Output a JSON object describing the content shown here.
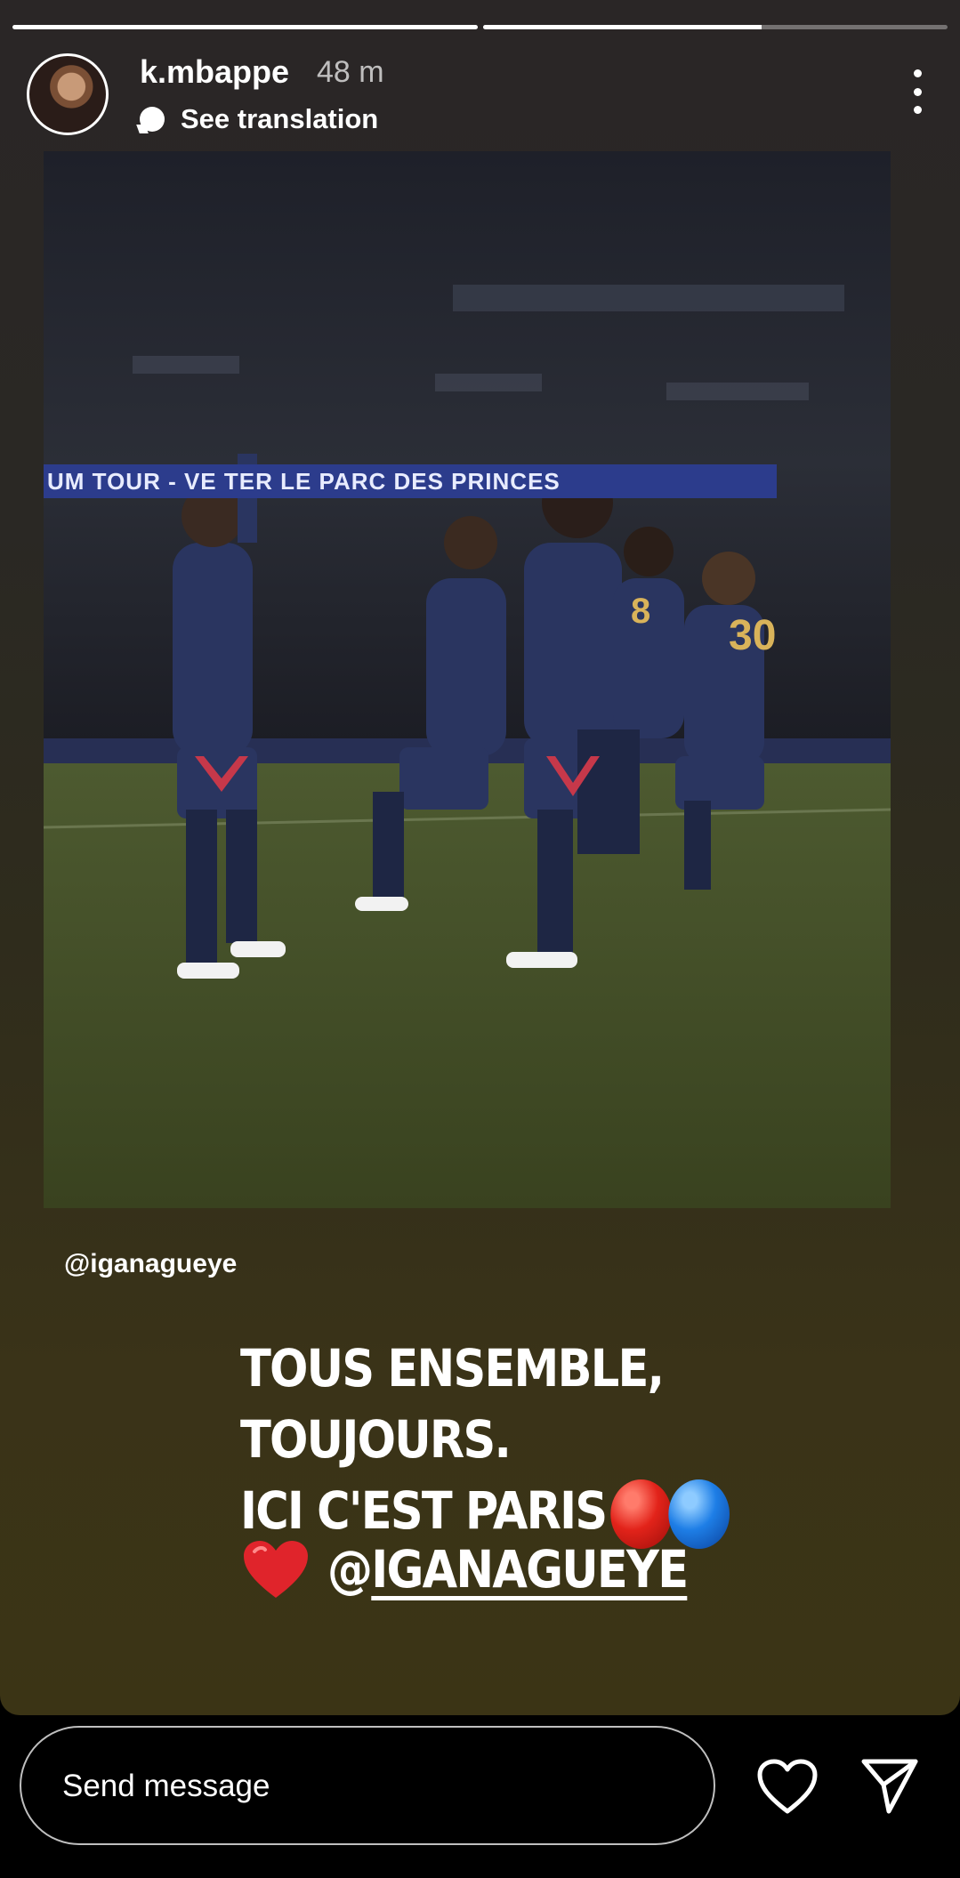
{
  "story": {
    "progress": [
      1.0,
      0.6
    ],
    "username": "k.mbappe",
    "time": "48 m",
    "translate_label": "See translation"
  },
  "photo": {
    "banner": "UM TOUR - VE    TER LE PARC DES PRINCES"
  },
  "caption": {
    "mention_tag": "@iganagueye",
    "line1": "TOUS ENSEMBLE, TOUJOURS.",
    "line2": "ICI C'EST PARIS",
    "mention_at": "@",
    "mention_name": "IGANAGUEYE"
  },
  "footer": {
    "message_placeholder": "Send message"
  },
  "colors": {
    "red_ball": "#e2231a",
    "blue_ball": "#1e7ee6",
    "heart": "#e0242b"
  },
  "icons": [
    "more-icon",
    "translate-icon",
    "heart-icon",
    "send-icon"
  ]
}
